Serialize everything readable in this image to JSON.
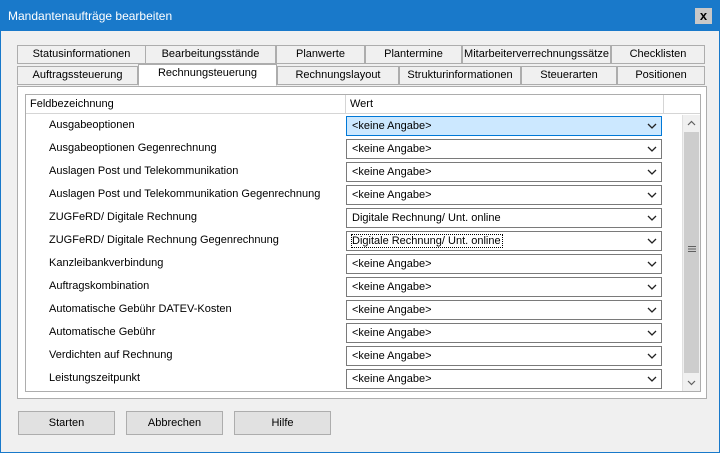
{
  "window": {
    "title": "Mandantenaufträge bearbeiten",
    "close_label": "x"
  },
  "tabs_row1": [
    "Statusinformationen",
    "Bearbeitungsstände",
    "Planwerte",
    "Plantermine",
    "Mitarbeiterverrechnungssätze",
    "Checklisten"
  ],
  "tabs_row2": [
    "Auftragssteuerung",
    "Rechnungsteuerung",
    "Rechnungslayout",
    "Strukturinformationen",
    "Steuerarten",
    "Positionen"
  ],
  "active_tab": "Rechnungsteuerung",
  "grid": {
    "headers": {
      "name": "Feldbezeichnung",
      "value": "Wert"
    },
    "rows": [
      {
        "label": "Ausgabeoptionen",
        "value": "<keine Angabe>",
        "focused": true
      },
      {
        "label": "Ausgabeoptionen Gegenrechnung",
        "value": "<keine Angabe>"
      },
      {
        "label": "Auslagen Post und Telekommunikation",
        "value": "<keine Angabe>"
      },
      {
        "label": "Auslagen Post und Telekommunikation Gegenrechnung",
        "value": "<keine Angabe>"
      },
      {
        "label": "ZUGFeRD/ Digitale Rechnung",
        "value": "Digitale Rechnung/ Unt. online"
      },
      {
        "label": "ZUGFeRD/ Digitale Rechnung Gegenrechnung",
        "value": "Digitale Rechnung/ Unt. online",
        "dotted": true
      },
      {
        "label": "Kanzleibankverbindung",
        "value": "<keine Angabe>"
      },
      {
        "label": "Auftragskombination",
        "value": "<keine Angabe>"
      },
      {
        "label": "Automatische Gebühr DATEV-Kosten",
        "value": "<keine Angabe>"
      },
      {
        "label": "Automatische Gebühr",
        "value": "<keine Angabe>"
      },
      {
        "label": "Verdichten auf Rechnung",
        "value": "<keine Angabe>"
      },
      {
        "label": "Leistungszeitpunkt",
        "value": "<keine Angabe>"
      }
    ]
  },
  "buttons": {
    "start": "Starten",
    "cancel": "Abbrechen",
    "help": "Hilfe"
  }
}
